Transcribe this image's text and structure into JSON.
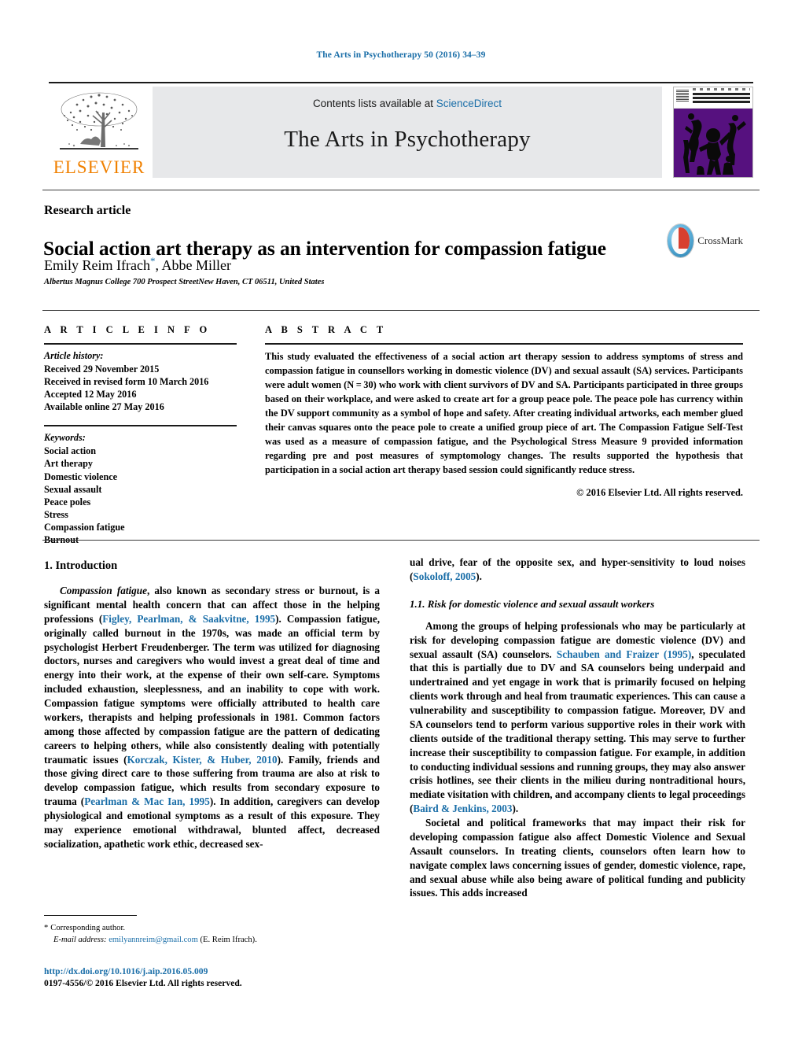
{
  "running_head": "The Arts in Psychotherapy 50 (2016) 34–39",
  "banner": {
    "publisher_logo_text": "ELSEVIER",
    "contents_prefix": "Contents lists available at ",
    "contents_link": "ScienceDirect",
    "journal_name": "The Arts in Psychotherapy",
    "cover_alt": "journal-cover-thumbnail"
  },
  "article": {
    "kind": "Research article",
    "title": "Social action art therapy as an intervention for compassion fatigue",
    "authors": "Emily Reim Ifrach",
    "author_marker": "*",
    "authors_rest": ", Abbe Miller",
    "affiliation": "Albertus Magnus College 700 Prospect StreetNew Haven, CT 06511, United States",
    "crossmark_label": "CrossMark"
  },
  "info": {
    "label": "A R T I C L E   I N F O",
    "history_label": "Article history:",
    "history": [
      "Received 29 November 2015",
      "Received in revised form 10 March 2016",
      "Accepted 12 May 2016",
      "Available online 27 May 2016"
    ],
    "keywords_label": "Keywords:",
    "keywords": [
      "Social action",
      "Art therapy",
      "Domestic violence",
      "Sexual assault",
      "Peace poles",
      "Stress",
      "Compassion fatigue",
      "Burnout"
    ]
  },
  "abstract": {
    "label": "A B S T R A C T",
    "text": "This study evaluated the effectiveness of a social action art therapy session to address symptoms of stress and compassion fatigue in counsellors working in domestic violence (DV) and sexual assault (SA) services. Participants were adult women (N = 30) who work with client survivors of DV and SA. Participants participated in three groups based on their workplace, and were asked to create art for a group peace pole. The peace pole has currency within the DV support community as a symbol of hope and safety. After creating individual artworks, each member glued their canvas squares onto the peace pole to create a unified group piece of art. The Compassion Fatigue Self-Test was used as a measure of compassion fatigue, and the Psychological Stress Measure 9 provided information regarding pre and post measures of symptomology changes. The results supported the hypothesis that participation in a social action art therapy based session could significantly reduce stress.",
    "copyright": "© 2016 Elsevier Ltd. All rights reserved."
  },
  "body": {
    "section1_heading": "1.  Introduction",
    "left_para1_lead": "Compassion fatigue",
    "left_para1_a": ", also known as secondary stress or burnout, is a significant mental health concern that can affect those in the helping professions (",
    "left_para1_cite1": "Figley, Pearlman, & Saakvitne, 1995",
    "left_para1_b": "). Compassion fatigue, originally called burnout in the 1970s, was made an official term by psychologist Herbert Freudenberger. The term was utilized for diagnosing doctors, nurses and caregivers who would invest a great deal of time and energy into their work, at the expense of their own self-care. Symptoms included exhaustion, sleeplessness, and an inability to cope with work. Compassion fatigue symptoms were officially attributed to health care workers, therapists and helping professionals in 1981. Common factors among those affected by compassion fatigue are the pattern of dedicating careers to helping others, while also consistently dealing with potentially traumatic issues (",
    "left_para1_cite2": "Korczak, Kister, & Huber, 2010",
    "left_para1_c": "). Family, friends and those giving direct care to those suffering from trauma are also at risk to develop compassion fatigue, which results from secondary exposure to trauma (",
    "left_para1_cite3": "Pearlman & Mac Ian, 1995",
    "left_para1_d": "). In addition, caregivers can develop physiological and emotional symptoms as a result of this exposure. They may experience emotional withdrawal, blunted affect, decreased socialization, apathetic work ethic, decreased sex-",
    "right_cont_a": "ual drive, fear of the opposite sex, and hyper-sensitivity to loud noises (",
    "right_cont_cite": "Sokoloff, 2005",
    "right_cont_b": ").",
    "section11_heading": "1.1.  Risk for domestic violence and sexual assault workers",
    "right_para1_a": "Among the groups of helping professionals who may be particularly at risk for developing compassion fatigue are domestic violence (DV) and sexual assault (SA) counselors. ",
    "right_para1_cite1": "Schauben and Fraizer (1995)",
    "right_para1_b": ", speculated that this is partially due to DV and SA counselors being underpaid and undertrained and yet engage in work that is primarily focused on helping clients work through and heal from traumatic experiences. This can cause a vulnerability and susceptibility to compassion fatigue. Moreover, DV and SA counselors tend to perform various supportive roles in their work with clients outside of the traditional therapy setting. This may serve to further increase their susceptibility to compassion fatigue. For example, in addition to conducting individual sessions and running groups, they may also answer crisis hotlines, see their clients in the milieu during nontraditional hours, mediate visitation with children, and accompany clients to legal proceedings (",
    "right_para1_cite2": "Baird & Jenkins, 2003",
    "right_para1_c": ").",
    "right_para2": "Societal and political frameworks that may impact their risk for developing compassion fatigue also affect Domestic Violence and Sexual Assault counselors. In treating clients, counselors often learn how to navigate complex laws concerning issues of gender, domestic violence, rape, and sexual abuse while also being aware of political funding and publicity issues. This adds increased"
  },
  "footer": {
    "corresponding_marker": "*",
    "corresponding_label": "Corresponding author.",
    "email_label": "E-mail address:",
    "email": "emilyannreim@gmail.com",
    "email_owner": "(E. Reim Ifrach).",
    "doi": "http://dx.doi.org/10.1016/j.aip.2016.05.009",
    "issn_line": "0197-4556/© 2016 Elsevier Ltd. All rights reserved."
  },
  "colors": {
    "link": "#1a6ea8",
    "elsevier_orange": "#f08000",
    "banner_bg": "#e7e8ea",
    "cover_purple": "#56117f"
  }
}
